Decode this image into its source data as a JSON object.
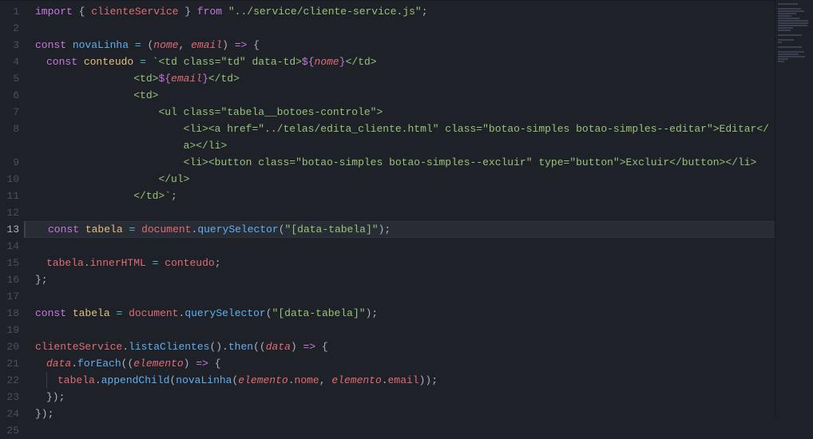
{
  "activeLine": 13,
  "lines": [
    {
      "n": 1,
      "html": "<span class='kw'>import</span><span class='punc'> { </span><span class='var'>clienteService</span><span class='punc'> } </span><span class='kw'>from</span><span class='punc'> </span><span class='str'>\"../service/cliente-service.js\"</span><span class='punc'>;</span>"
    },
    {
      "n": 2,
      "html": ""
    },
    {
      "n": 3,
      "html": "<span class='kw'>const</span><span class='punc'> </span><span class='fn'>novaLinha</span><span class='punc'> </span><span class='op'>=</span><span class='punc'> (</span><span class='param'>nome</span><span class='punc'>, </span><span class='param'>email</span><span class='punc'>) </span><span class='kw'>=&gt;</span><span class='punc'> {</span>"
    },
    {
      "n": 4,
      "indent": 1,
      "html": "<span class='kw'>const</span><span class='punc'> </span><span class='builtin'>conteudo</span><span class='punc'> </span><span class='op'>=</span><span class='punc'> </span><span class='tmpl'>`&lt;td class=\"td\" data-td&gt;</span><span class='tmplexp'>${</span><span class='param'>nome</span><span class='tmplexp'>}</span><span class='tmpl'>&lt;/td&gt;</span>"
    },
    {
      "n": 5,
      "indent": 1,
      "pre": "              ",
      "html": "<span class='tmpl'>&lt;td&gt;</span><span class='tmplexp'>${</span><span class='param'>email</span><span class='tmplexp'>}</span><span class='tmpl'>&lt;/td&gt;</span>"
    },
    {
      "n": 6,
      "indent": 1,
      "pre": "              ",
      "html": "<span class='tmpl'>&lt;td&gt;</span>"
    },
    {
      "n": 7,
      "indent": 1,
      "pre": "                  ",
      "html": "<span class='tmpl'>&lt;ul class=\"tabela__botoes-controle\"&gt;</span>"
    },
    {
      "n": 8,
      "indent": 1,
      "pre": "                      ",
      "html": "<span class='tmpl'>&lt;li&gt;&lt;a href=\"../telas/edita_cliente.html\" class=\"botao-simples botao-simples--editar\"&gt;Editar&lt;/</span>",
      "wrap": "<span class='tmpl'>a&gt;&lt;/li&gt;</span>",
      "wrapPre": "                      "
    },
    {
      "n": 9,
      "indent": 1,
      "pre": "                      ",
      "html": "<span class='tmpl'>&lt;li&gt;&lt;button class=\"botao-simples botao-simples--excluir\" type=\"button\"&gt;Excluir&lt;/button&gt;&lt;/li&gt;</span>"
    },
    {
      "n": 10,
      "indent": 1,
      "pre": "                  ",
      "html": "<span class='tmpl'>&lt;/ul&gt;</span>"
    },
    {
      "n": 11,
      "indent": 1,
      "pre": "              ",
      "html": "<span class='tmpl'>&lt;/td&gt;`</span><span class='punc'>;</span>"
    },
    {
      "n": 12,
      "html": ""
    },
    {
      "n": 13,
      "indent": 1,
      "highlighted": true,
      "html": "<span class='kw'>const</span><span class='punc'> </span><span class='builtin'>tabela</span><span class='punc'> </span><span class='op'>=</span><span class='punc'> </span><span class='var'>document</span><span class='punc'>.</span><span class='fn'>querySelector</span><span class='punc'>(</span><span class='str'>\"[data-tabela]\"</span><span class='punc'>);</span>"
    },
    {
      "n": 14,
      "html": ""
    },
    {
      "n": 15,
      "indent": 1,
      "html": "<span class='var'>tabela</span><span class='punc'>.</span><span class='prop'>innerHTML</span><span class='punc'> </span><span class='op'>=</span><span class='punc'> </span><span class='var'>conteudo</span><span class='punc'>;</span>"
    },
    {
      "n": 16,
      "html": "<span class='punc'>};</span>"
    },
    {
      "n": 17,
      "html": ""
    },
    {
      "n": 18,
      "html": "<span class='kw'>const</span><span class='punc'> </span><span class='builtin'>tabela</span><span class='punc'> </span><span class='op'>=</span><span class='punc'> </span><span class='var'>document</span><span class='punc'>.</span><span class='fn'>querySelector</span><span class='punc'>(</span><span class='str'>\"[data-tabela]\"</span><span class='punc'>);</span>"
    },
    {
      "n": 19,
      "html": ""
    },
    {
      "n": 20,
      "html": "<span class='var'>clienteService</span><span class='punc'>.</span><span class='fn'>listaClientes</span><span class='punc'>().</span><span class='fn'>then</span><span class='punc'>((</span><span class='param'>data</span><span class='punc'>) </span><span class='kw'>=&gt;</span><span class='punc'> {</span>"
    },
    {
      "n": 21,
      "indent": 1,
      "html": "<span class='param'>data</span><span class='punc'>.</span><span class='fn'>forEach</span><span class='punc'>((</span><span class='param'>elemento</span><span class='punc'>) </span><span class='kw'>=&gt;</span><span class='punc'> {</span>"
    },
    {
      "n": 22,
      "indent": 2,
      "html": "<span class='var'>tabela</span><span class='punc'>.</span><span class='fn'>appendChild</span><span class='punc'>(</span><span class='fn'>novaLinha</span><span class='punc'>(</span><span class='param'>elemento</span><span class='punc'>.</span><span class='prop'>nome</span><span class='punc'>, </span><span class='param'>elemento</span><span class='punc'>.</span><span class='prop'>email</span><span class='punc'>));</span>"
    },
    {
      "n": 23,
      "indent": 1,
      "html": "<span class='punc'>});</span>"
    },
    {
      "n": 24,
      "html": "<span class='punc'>});</span>"
    },
    {
      "n": 25,
      "html": ""
    }
  ],
  "minimap": [
    60,
    0,
    70,
    78,
    55,
    40,
    65,
    90,
    90,
    88,
    45,
    38,
    0,
    72,
    0,
    48,
    12,
    0,
    72,
    0,
    78,
    62,
    80,
    30,
    20,
    0
  ]
}
